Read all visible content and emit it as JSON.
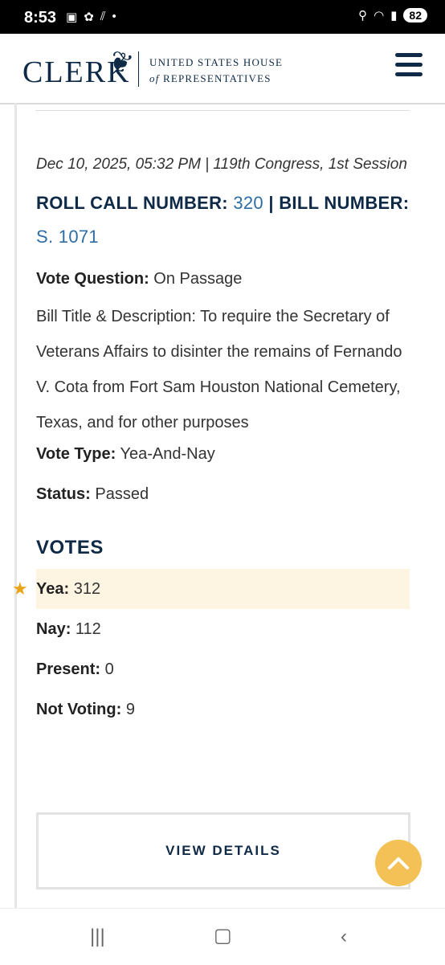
{
  "status_bar": {
    "time": "8:53",
    "battery": "82",
    "left_icons": [
      "screenshot-icon",
      "openai-icon",
      "signal-strength-icon",
      "dot-icon"
    ],
    "right_icons": [
      "location-icon",
      "wifi-icon",
      "cell-signal-icon",
      "battery-icon"
    ]
  },
  "header": {
    "logo_word": "CLERK",
    "logo_line1": "UNITED STATES HOUSE",
    "logo_line2_of": "of",
    "logo_line2_rest": " REPRESENTATIVES",
    "menu_icon": "hamburger-menu-icon"
  },
  "vote": {
    "dateline": "Dec 10, 2025, 05:32 PM | 119th Congress, 1st Session",
    "roll_call_label": "ROLL CALL NUMBER: ",
    "roll_call_number": "320",
    "bill_separator": " | BILL NUMBER: ",
    "bill_number": "S. 1071",
    "question_label": "Vote Question:",
    "question_value": " On Passage",
    "description": "Bill Title & Description: To require the Secretary of Veterans Affairs to disinter the remains of Fernando V. Cota from Fort Sam Houston National Cemetery, Texas, and for other purposes",
    "type_label": "Vote Type:",
    "type_value": " Yea-And-Nay",
    "status_label": "Status:",
    "status_value": " Passed"
  },
  "votes": {
    "heading": "VOTES",
    "rows": [
      {
        "label": "Yea:",
        "value": " 312",
        "winner": true
      },
      {
        "label": "Nay:",
        "value": " 112"
      },
      {
        "label": "Present:",
        "value": " 0"
      },
      {
        "label": "Not Voting:",
        "value": " 9"
      }
    ],
    "winner_icon": "star-icon",
    "view_details": "VIEW DETAILS"
  },
  "colors": {
    "navy": "#0e2a47",
    "link": "#2e6da4",
    "highlight": "#fdf5e2",
    "star": "#e8a317",
    "scroll_button": "#f3c155"
  },
  "nav_bar": {
    "icons": [
      "recent-apps-icon",
      "home-icon",
      "back-icon"
    ]
  }
}
